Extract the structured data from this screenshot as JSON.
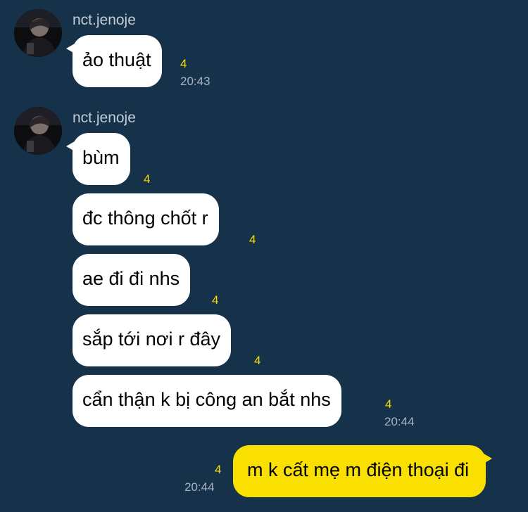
{
  "messages": [
    {
      "sender": "nct.jenoje",
      "text": "ảo thuật",
      "unread": "4",
      "time": "20:43"
    },
    {
      "sender": "nct.jenoje",
      "bubbles": [
        {
          "text": "bùm",
          "unread": "4"
        },
        {
          "text": "đc thông chốt r",
          "unread": "4"
        },
        {
          "text": "ae đi đi nhs",
          "unread": "4"
        },
        {
          "text": "sắp tới nơi r đây",
          "unread": "4"
        },
        {
          "text": "cẩn thận k bị công an bắt nhs",
          "unread": "4"
        }
      ],
      "time": "20:44"
    },
    {
      "self": true,
      "text": "m k cất mẹ m điện thoại đi",
      "unread": "4",
      "time": "20:44"
    }
  ],
  "colors": {
    "background": "#16324a",
    "incoming_bubble": "#ffffff",
    "outgoing_bubble": "#f9e000",
    "unread_count": "#f5dc00",
    "timestamp": "#a8b4c0",
    "sender_name": "#c2ccd6"
  }
}
